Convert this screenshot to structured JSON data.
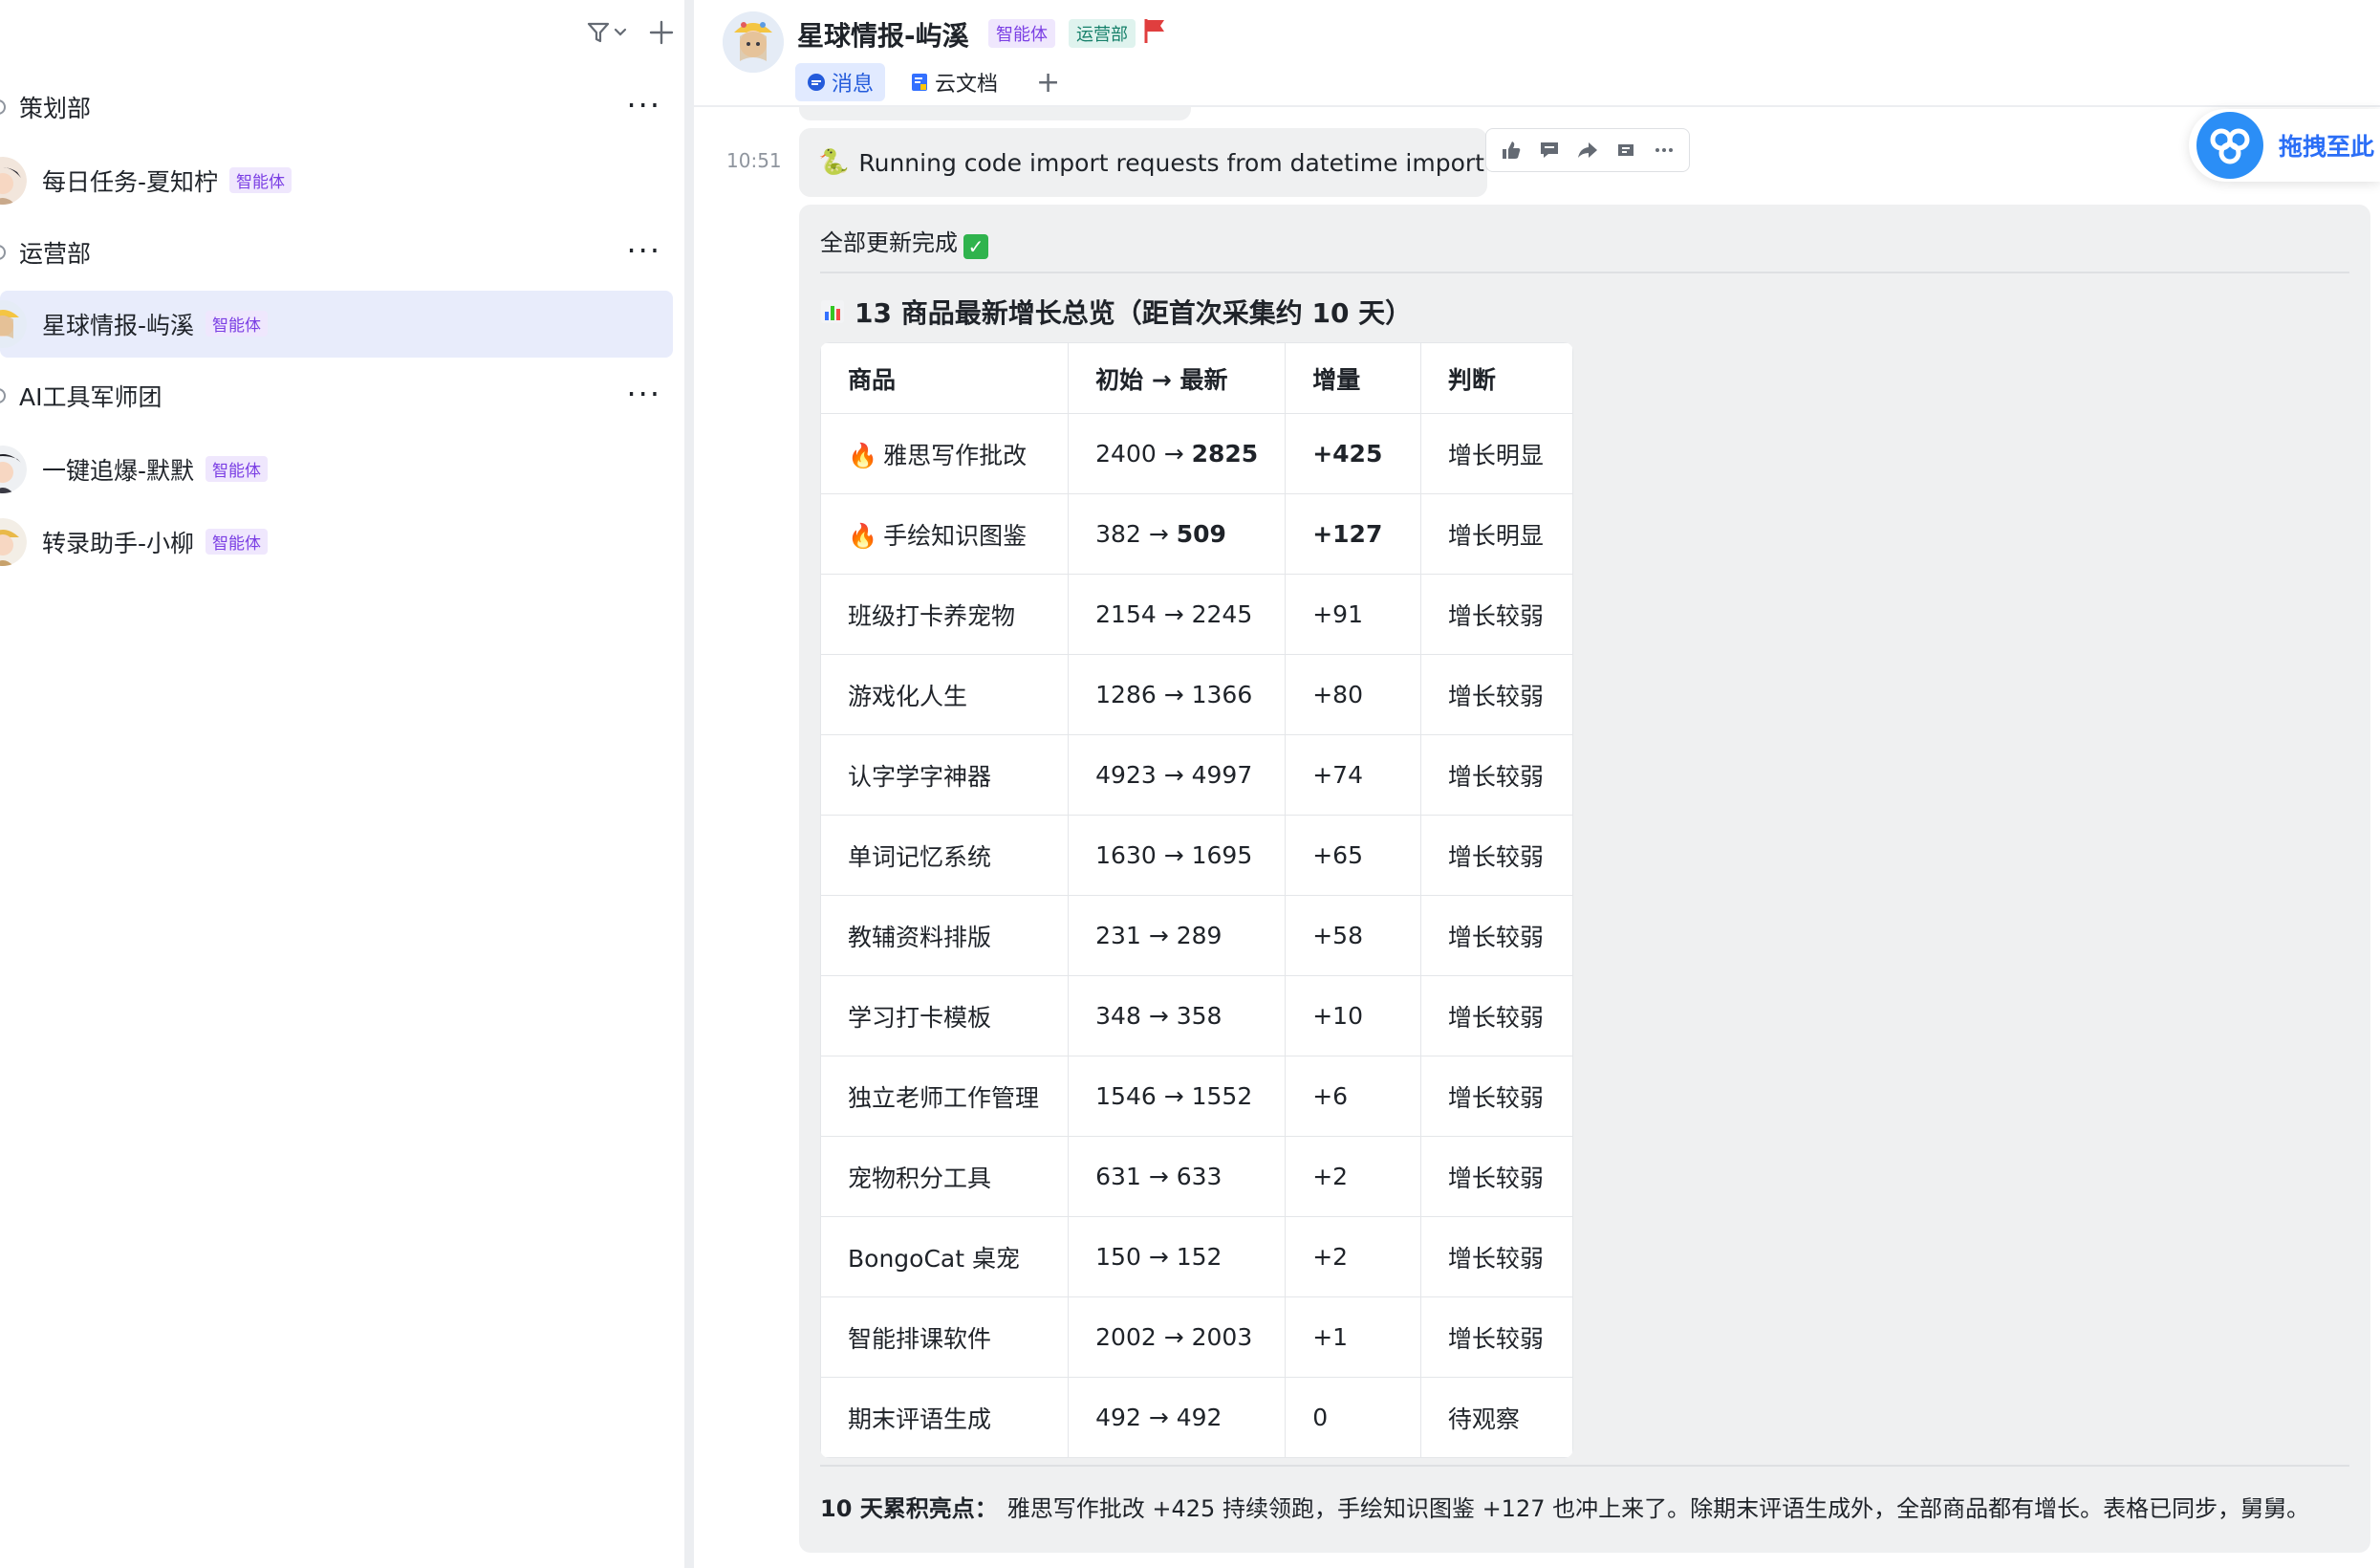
{
  "sidebar": {
    "groups": [
      {
        "name": "策划部"
      },
      {
        "name": "运营部"
      },
      {
        "name": "AI工具军师团"
      }
    ],
    "items": [
      {
        "label": "每日任务-夏知柠",
        "badge": "智能体"
      },
      {
        "label": "星球情报-屿溪",
        "badge": "智能体",
        "active": true
      },
      {
        "label": "一键追爆-默默",
        "badge": "智能体"
      },
      {
        "label": "转录助手-小柳",
        "badge": "智能体"
      }
    ],
    "more_glyph": "···"
  },
  "header": {
    "title": "星球情报-屿溪",
    "badge_ai": "智能体",
    "badge_dept": "运营部",
    "tabs": [
      {
        "label": "消息",
        "active": true
      },
      {
        "label": "云文档"
      }
    ],
    "add_tab": "+"
  },
  "message": {
    "time": "10:51",
    "code_text": "Running code import requests from datetime import ...",
    "drag_label": "拖拽至此",
    "done_text": "全部更新完成",
    "section_title": "13 商品最新增长总览（距首次采集约 10 天）",
    "table": {
      "headers": [
        "商品",
        "初始 → 最新",
        "增量",
        "判断"
      ],
      "rows": [
        {
          "fire": true,
          "name": "雅思写作批改",
          "start": "2400",
          "latest": "2825",
          "delta": "+425",
          "verdict": "增长明显",
          "bold": true
        },
        {
          "fire": true,
          "name": "手绘知识图鉴",
          "start": "382",
          "latest": "509",
          "delta": "+127",
          "verdict": "增长明显",
          "bold": true
        },
        {
          "fire": false,
          "name": "班级打卡养宠物",
          "start": "2154",
          "latest": "2245",
          "delta": "+91",
          "verdict": "增长较弱"
        },
        {
          "fire": false,
          "name": "游戏化人生",
          "start": "1286",
          "latest": "1366",
          "delta": "+80",
          "verdict": "增长较弱"
        },
        {
          "fire": false,
          "name": "认字学字神器",
          "start": "4923",
          "latest": "4997",
          "delta": "+74",
          "verdict": "增长较弱"
        },
        {
          "fire": false,
          "name": "单词记忆系统",
          "start": "1630",
          "latest": "1695",
          "delta": "+65",
          "verdict": "增长较弱"
        },
        {
          "fire": false,
          "name": "教辅资料排版",
          "start": "231",
          "latest": "289",
          "delta": "+58",
          "verdict": "增长较弱"
        },
        {
          "fire": false,
          "name": "学习打卡模板",
          "start": "348",
          "latest": "358",
          "delta": "+10",
          "verdict": "增长较弱"
        },
        {
          "fire": false,
          "name": "独立老师工作管理",
          "start": "1546",
          "latest": "1552",
          "delta": "+6",
          "verdict": "增长较弱"
        },
        {
          "fire": false,
          "name": "宠物积分工具",
          "start": "631",
          "latest": "633",
          "delta": "+2",
          "verdict": "增长较弱"
        },
        {
          "fire": false,
          "name": "BongoCat 桌宠",
          "start": "150",
          "latest": "152",
          "delta": "+2",
          "verdict": "增长较弱"
        },
        {
          "fire": false,
          "name": "智能排课软件",
          "start": "2002",
          "latest": "2003",
          "delta": "+1",
          "verdict": "增长较弱"
        },
        {
          "fire": false,
          "name": "期末评语生成",
          "start": "492",
          "latest": "492",
          "delta": "0",
          "verdict": "待观察"
        }
      ]
    },
    "summary_label": "10 天累积亮点：",
    "summary_text": "雅思写作批改 +425 持续领跑，手绘知识图鉴 +127 也冲上来了。除期末评语生成外，全部商品都有增长。表格已同步，舅舅。"
  },
  "colors": {
    "active_item_bg": "#e8ecfb",
    "bubble_bg": "#eff0f1",
    "badge_ai": "#7b3fe4",
    "badge_dept": "#16806a",
    "tab_active": "#245bdb",
    "drag_accent": "#2b6ef6"
  },
  "icons": [
    "filter-icon",
    "chevron-down-icon",
    "plus-icon",
    "more-icon",
    "chat-bubble-icon",
    "doc-icon",
    "flag-icon",
    "thumbs-up-icon",
    "comment-icon",
    "forward-icon",
    "pin-icon",
    "bar-chart-icon",
    "fire-icon",
    "check-icon",
    "snake-icon",
    "cloud-drive-icon"
  ]
}
